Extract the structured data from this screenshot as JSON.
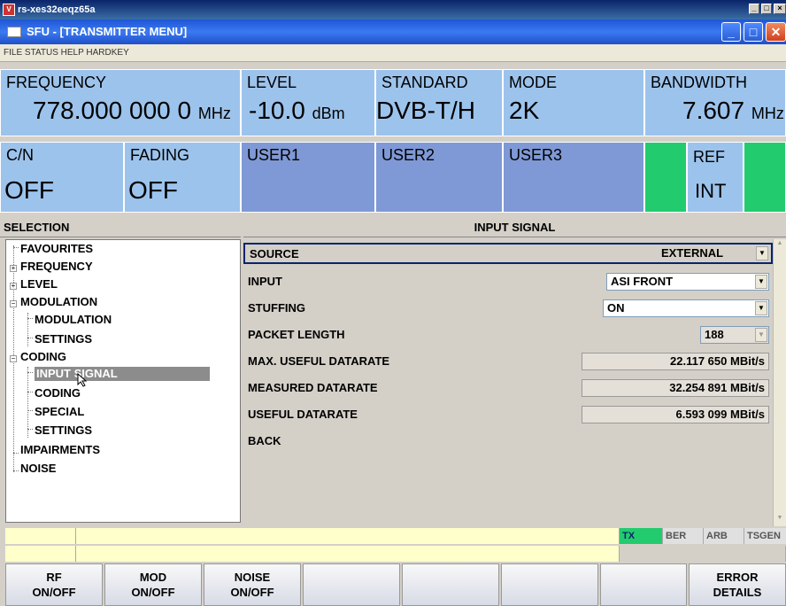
{
  "outer_window": {
    "title": "rs-xes32eeqz65a",
    "logo": "V"
  },
  "inner_window": {
    "title": "SFU - [TRANSMITTER MENU]"
  },
  "menubar": {
    "items": [
      "FILE",
      "STATUS",
      "HELP",
      "HARDKEY"
    ]
  },
  "header": {
    "frequency": {
      "label": "FREQUENCY",
      "value": "778.000 000 0",
      "unit": "MHz"
    },
    "level": {
      "label": "LEVEL",
      "value": "-10.0",
      "unit": "dBm"
    },
    "standard": {
      "label": "STANDARD",
      "value": "DVB-T/H"
    },
    "mode": {
      "label": "MODE",
      "value": "2K"
    },
    "bandwidth": {
      "label": "BANDWIDTH",
      "value": "7.607",
      "unit": "MHz"
    },
    "cn": {
      "label": "C/N",
      "value": "OFF"
    },
    "fading": {
      "label": "FADING",
      "value": "OFF"
    },
    "user1": "USER1",
    "user2": "USER2",
    "user3": "USER3",
    "ref": {
      "label": "REF",
      "value": "INT"
    }
  },
  "selection": {
    "title": "SELECTION",
    "tree": [
      "FAVOURITES",
      "FREQUENCY",
      "LEVEL",
      "MODULATION",
      "MODULATION",
      "SETTINGS",
      "CODING",
      "INPUT SIGNAL",
      "CODING",
      "SPECIAL",
      "SETTINGS",
      "IMPAIRMENTS",
      "NOISE"
    ],
    "selected": "INPUT SIGNAL"
  },
  "input_signal": {
    "title": "INPUT SIGNAL",
    "rows": [
      {
        "label": "SOURCE",
        "value": "EXTERNAL"
      },
      {
        "label": "INPUT",
        "value": "ASI FRONT"
      },
      {
        "label": "STUFFING",
        "value": "ON"
      },
      {
        "label": "PACKET LENGTH",
        "value": "188"
      },
      {
        "label": "MAX. USEFUL DATARATE",
        "value": "22.117 650",
        "unit": "MBit/s"
      },
      {
        "label": "MEASURED DATARATE",
        "value": "32.254 891",
        "unit": "MBit/s"
      },
      {
        "label": "USEFUL DATARATE",
        "value": "6.593 099",
        "unit": "MBit/s"
      },
      {
        "label": "BACK"
      }
    ]
  },
  "status_flags": [
    "TX",
    "BER",
    "ARB",
    "TSGEN"
  ],
  "softkeys": [
    "RF\nON/OFF",
    "MOD\nON/OFF",
    "NOISE\nON/OFF",
    "",
    "",
    "",
    "",
    "ERROR\nDETAILS"
  ],
  "colors": {
    "header_blue": "#9cc3ec",
    "user_blue": "#7f99d6",
    "ref_green": "#22cc6e",
    "status_yellow": "#ffffcc",
    "selected_gray": "#8c8c8c"
  }
}
